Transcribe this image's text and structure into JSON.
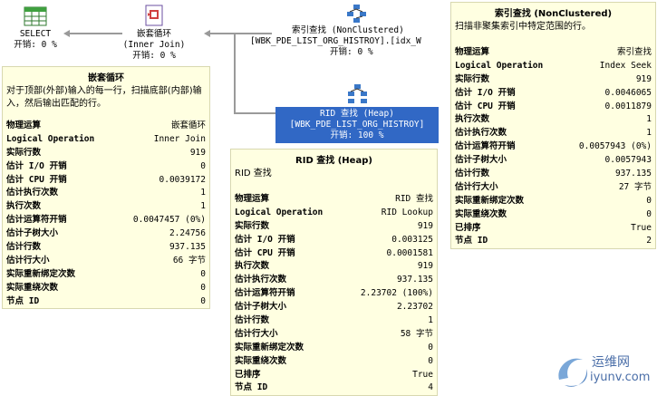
{
  "nodes": {
    "select": {
      "name": "SELECT",
      "cost": "开销: 0 %"
    },
    "nested_loop": {
      "name": "嵌套循环",
      "sub": "(Inner Join)",
      "cost": "开销: 0 %"
    },
    "index_seek": {
      "name": "索引查找 (NonClustered)",
      "sub": "[WBK_PDE_LIST_ORG_HISTROY].[idx_W",
      "cost": "开销: 0 %"
    },
    "rid_lookup": {
      "name": "RID 查找 (Heap)",
      "sub": "[WBK_PDE_LIST_ORG_HISTROY]",
      "cost": "开销: 100 %"
    }
  },
  "tips": {
    "nested": {
      "title": "嵌套循环",
      "desc": "对于顶部(外部)输入的每一行，扫描底部(内部)输入，然后输出匹配的行。",
      "rows": [
        {
          "k": "物理运算",
          "v": "嵌套循环"
        },
        {
          "k": "Logical Operation",
          "v": "Inner Join"
        },
        {
          "k": "实际行数",
          "v": "919"
        },
        {
          "k": "估计 I/O 开销",
          "v": "0"
        },
        {
          "k": "估计 CPU 开销",
          "v": "0.0039172"
        },
        {
          "k": "估计执行次数",
          "v": "1"
        },
        {
          "k": "执行次数",
          "v": "1"
        },
        {
          "k": "估计运算符开销",
          "v": "0.0047457 (0%)"
        },
        {
          "k": "估计子树大小",
          "v": "2.24756"
        },
        {
          "k": "估计行数",
          "v": "937.135"
        },
        {
          "k": "估计行大小",
          "v": "66 字节"
        },
        {
          "k": "实际重新绑定次数",
          "v": "0"
        },
        {
          "k": "实际重绕次数",
          "v": "0"
        },
        {
          "k": "节点 ID",
          "v": "0"
        }
      ]
    },
    "rid": {
      "title": "RID 查找 (Heap)",
      "desc": "RID 查找",
      "rows": [
        {
          "k": "物理运算",
          "v": "RID 查找"
        },
        {
          "k": "Logical Operation",
          "v": "RID Lookup"
        },
        {
          "k": "实际行数",
          "v": "919"
        },
        {
          "k": "估计 I/O 开销",
          "v": "0.003125"
        },
        {
          "k": "估计 CPU 开销",
          "v": "0.0001581"
        },
        {
          "k": "执行次数",
          "v": "919"
        },
        {
          "k": "估计执行次数",
          "v": "937.135"
        },
        {
          "k": "估计运算符开销",
          "v": "2.23702 (100%)"
        },
        {
          "k": "估计子树大小",
          "v": "2.23702"
        },
        {
          "k": "估计行数",
          "v": "1"
        },
        {
          "k": "估计行大小",
          "v": "58 字节"
        },
        {
          "k": "实际重新绑定次数",
          "v": "0"
        },
        {
          "k": "实际重绕次数",
          "v": "0"
        },
        {
          "k": "已排序",
          "v": "True"
        },
        {
          "k": "节点 ID",
          "v": "4"
        }
      ]
    },
    "seek": {
      "title": "索引查找 (NonClustered)",
      "desc": "扫描非聚集索引中特定范围的行。",
      "rows": [
        {
          "k": "物理运算",
          "v": "索引查找"
        },
        {
          "k": "Logical Operation",
          "v": "Index Seek"
        },
        {
          "k": "实际行数",
          "v": "919"
        },
        {
          "k": "估计 I/O 开销",
          "v": "0.0046065"
        },
        {
          "k": "估计 CPU 开销",
          "v": "0.0011879"
        },
        {
          "k": "执行次数",
          "v": "1"
        },
        {
          "k": "估计执行次数",
          "v": "1"
        },
        {
          "k": "估计运算符开销",
          "v": "0.0057943 (0%)"
        },
        {
          "k": "估计子树大小",
          "v": "0.0057943"
        },
        {
          "k": "估计行数",
          "v": "937.135"
        },
        {
          "k": "估计行大小",
          "v": "27 字节"
        },
        {
          "k": "实际重新绑定次数",
          "v": "0"
        },
        {
          "k": "实际重绕次数",
          "v": "0"
        },
        {
          "k": "已排序",
          "v": "True"
        },
        {
          "k": "节点 ID",
          "v": "2"
        }
      ]
    }
  },
  "watermark": {
    "cn": "运维网",
    "url": "iyunv.com"
  },
  "colors": {
    "tip_bg": "#ffffe1",
    "selected_bg": "#3168c5"
  }
}
